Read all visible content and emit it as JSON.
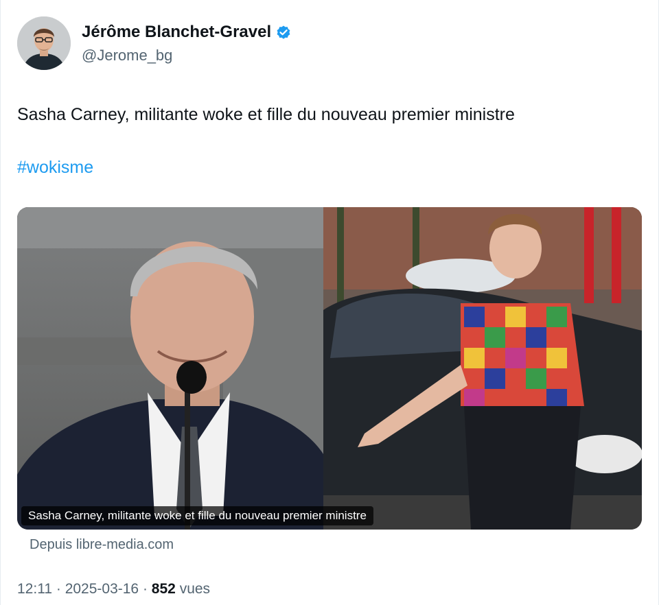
{
  "author": {
    "display_name": "Jérôme Blanchet-Gravel",
    "handle": "@Jerome_bg",
    "verified": true
  },
  "tweet": {
    "text": "Sasha Carney, militante woke et fille du nouveau premier ministre",
    "hashtag": "#wokisme"
  },
  "media": {
    "caption": "Sasha Carney, militante woke et fille du nouveau premier ministre",
    "source": "Depuis libre-media.com"
  },
  "meta": {
    "time": "12:11",
    "separator": "·",
    "date": "2025-03-16",
    "views_count": "852",
    "views_label": "vues"
  },
  "colors": {
    "link": "#1d9bf0",
    "secondary_text": "#536471",
    "verified_badge": "#1d9bf0"
  }
}
